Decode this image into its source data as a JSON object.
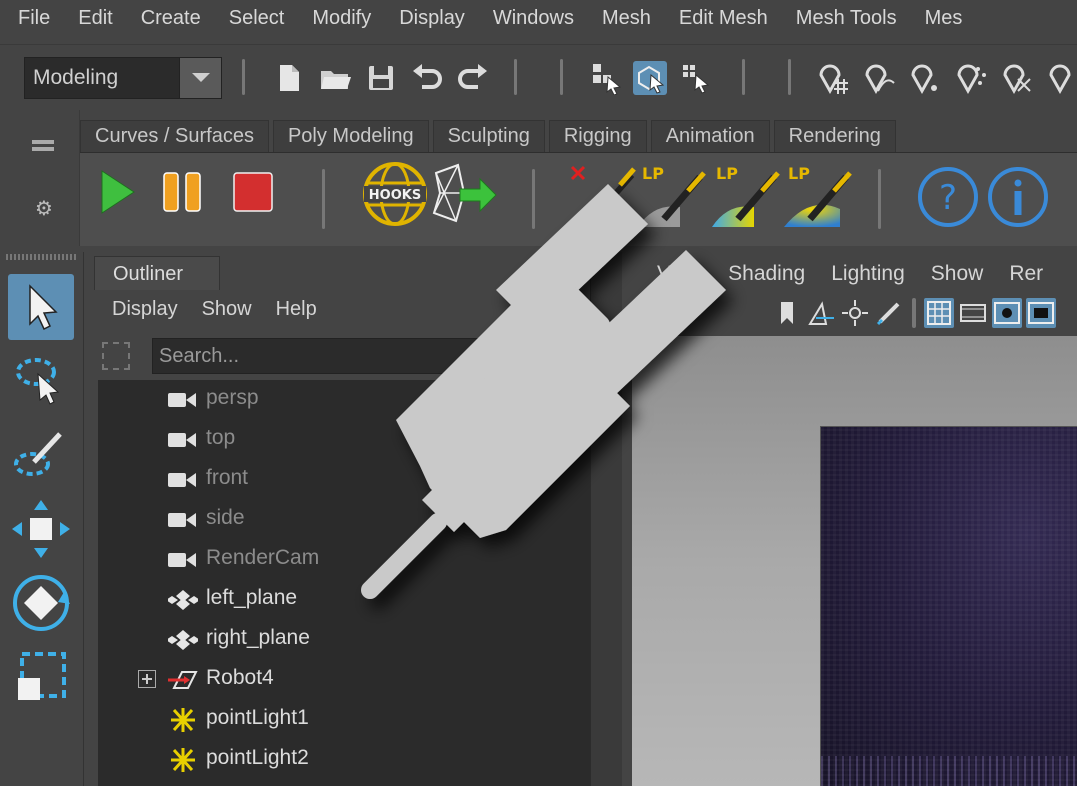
{
  "menubar": {
    "items": [
      "File",
      "Edit",
      "Create",
      "Select",
      "Modify",
      "Display",
      "Windows",
      "Mesh",
      "Edit Mesh",
      "Mesh Tools",
      "Mes"
    ]
  },
  "statusline": {
    "mode": "Modeling"
  },
  "shelf": {
    "tabs": [
      "Curves / Surfaces",
      "Poly Modeling",
      "Sculpting",
      "Rigging",
      "Animation",
      "Rendering"
    ],
    "hooks_label": "HOOKS",
    "lp_label": "LP"
  },
  "outliner": {
    "tab": "Outliner",
    "menu": [
      "Display",
      "Show",
      "Help"
    ],
    "search_placeholder": "Search...",
    "items": [
      {
        "label": "persp",
        "type": "camera",
        "dim": true
      },
      {
        "label": "top",
        "type": "camera",
        "dim": true
      },
      {
        "label": "front",
        "type": "camera",
        "dim": true
      },
      {
        "label": "side",
        "type": "camera",
        "dim": true
      },
      {
        "label": "RenderCam",
        "type": "camera",
        "dim": true
      },
      {
        "label": "left_plane",
        "type": "mesh",
        "dim": false
      },
      {
        "label": "right_plane",
        "type": "mesh",
        "dim": false
      },
      {
        "label": "Robot4",
        "type": "group",
        "dim": false
      },
      {
        "label": "pointLight1",
        "type": "light",
        "dim": false
      },
      {
        "label": "pointLight2",
        "type": "light",
        "dim": false
      }
    ]
  },
  "viewport": {
    "menu": [
      "View",
      "Shading",
      "Lighting",
      "Show",
      "Rer"
    ]
  },
  "colors": {
    "accent": "#5d8fb4",
    "play_green": "#3fbf3f",
    "pause_orange": "#f0a020",
    "stop_red": "#d32f2f",
    "help_blue": "#3a8ad8",
    "plug_gray": "#c9c9c9"
  }
}
